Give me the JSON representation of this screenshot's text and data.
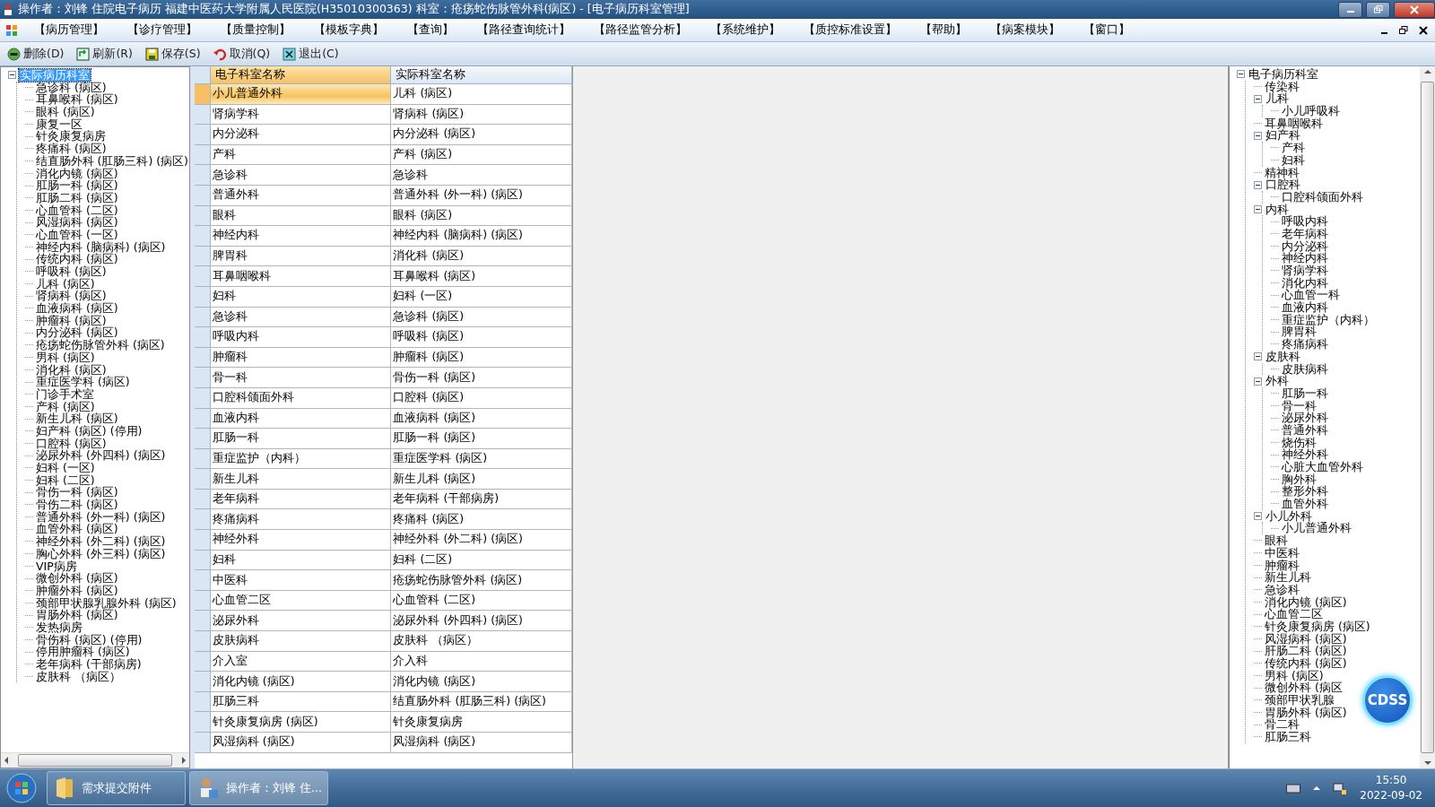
{
  "window": {
    "title": "操作者：刘锋 住院电子病历  福建中医药大学附属人民医院(H35010300363)  科室：疮疡蛇伤脉管外科(病区) - [电子病历科室管理]"
  },
  "menu": [
    "【病历管理】",
    "【诊疗管理】",
    "【质量控制】",
    "【模板字典】",
    "【查询】",
    "【路径查询统计】",
    "【路径监管分析】",
    "【系统维护】",
    "【质控标准设置】",
    "【帮助】",
    "【病案模块】",
    "【窗口】"
  ],
  "toolbar": [
    {
      "kind": "delete",
      "label": "删除(D)"
    },
    {
      "kind": "refresh",
      "label": "刷新(R)"
    },
    {
      "kind": "save",
      "label": "保存(S)"
    },
    {
      "kind": "cancel",
      "label": "取消(Q)"
    },
    {
      "kind": "exit",
      "label": "退出(C)"
    }
  ],
  "left_tree": {
    "label": "实际病历科室",
    "expanded": true,
    "selected": true,
    "children": [
      {
        "label": "急诊科 (病区)"
      },
      {
        "label": "耳鼻喉科 (病区)"
      },
      {
        "label": "眼科 (病区)"
      },
      {
        "label": "康复一区"
      },
      {
        "label": "针灸康复病房"
      },
      {
        "label": "疼痛科 (病区)"
      },
      {
        "label": "结直肠外科 (肛肠三科) (病区)"
      },
      {
        "label": "消化内镜 (病区)"
      },
      {
        "label": "肛肠一科 (病区)"
      },
      {
        "label": "肛肠二科 (病区)"
      },
      {
        "label": "心血管科 (二区)"
      },
      {
        "label": "风湿病科 (病区)"
      },
      {
        "label": "心血管科 (一区)"
      },
      {
        "label": "神经内科 (脑病科) (病区)"
      },
      {
        "label": "传统内科 (病区)"
      },
      {
        "label": "呼吸科 (病区)"
      },
      {
        "label": "儿科 (病区)"
      },
      {
        "label": "肾病科 (病区)"
      },
      {
        "label": "血液病科 (病区)"
      },
      {
        "label": "肿瘤科 (病区)"
      },
      {
        "label": "内分泌科 (病区)"
      },
      {
        "label": "疮疡蛇伤脉管外科 (病区)"
      },
      {
        "label": "男科 (病区)"
      },
      {
        "label": "消化科 (病区)"
      },
      {
        "label": "重症医学科 (病区)"
      },
      {
        "label": "门诊手术室"
      },
      {
        "label": "产科 (病区)"
      },
      {
        "label": "新生儿科 (病区)"
      },
      {
        "label": "妇产科 (病区) (停用)"
      },
      {
        "label": "口腔科 (病区)"
      },
      {
        "label": "泌尿外科 (外四科) (病区)"
      },
      {
        "label": "妇科 (一区)"
      },
      {
        "label": "妇科 (二区)"
      },
      {
        "label": "骨伤一科 (病区)"
      },
      {
        "label": "骨伤二科 (病区)"
      },
      {
        "label": "普通外科 (外一科) (病区)"
      },
      {
        "label": "血管外科 (病区)"
      },
      {
        "label": "神经外科 (外二科) (病区)"
      },
      {
        "label": "胸心外科 (外三科) (病区)"
      },
      {
        "label": "VIP病房"
      },
      {
        "label": "微创外科 (病区)"
      },
      {
        "label": "肿瘤外科 (病区)"
      },
      {
        "label": "颈部甲状腺乳腺外科 (病区)"
      },
      {
        "label": "胃肠外科 (病区)"
      },
      {
        "label": "发热病房"
      },
      {
        "label": "骨伤科 (病区) (停用)"
      },
      {
        "label": "停用肿瘤科 (病区)"
      },
      {
        "label": "老年病科 (干部病房)"
      },
      {
        "label": "皮肤科 （病区）"
      }
    ]
  },
  "table": {
    "columns": [
      "电子科室名称",
      "实际科室名称"
    ],
    "rows": [
      {
        "cells": [
          "小儿普通外科",
          "儿科 (病区)"
        ],
        "selected": true
      },
      {
        "cells": [
          "肾病学科",
          "肾病科 (病区)"
        ],
        "selected": false
      },
      {
        "cells": [
          "内分泌科",
          "内分泌科 (病区)"
        ],
        "selected": false
      },
      {
        "cells": [
          "产科",
          "产科 (病区)"
        ],
        "selected": false
      },
      {
        "cells": [
          "急诊科",
          "急诊科"
        ],
        "selected": false
      },
      {
        "cells": [
          "普通外科",
          "普通外科 (外一科) (病区)"
        ],
        "selected": false
      },
      {
        "cells": [
          "眼科",
          "眼科 (病区)"
        ],
        "selected": false
      },
      {
        "cells": [
          "神经内科",
          "神经内科 (脑病科) (病区)"
        ],
        "selected": false
      },
      {
        "cells": [
          "脾胃科",
          "消化科 (病区)"
        ],
        "selected": false
      },
      {
        "cells": [
          "耳鼻咽喉科",
          "耳鼻喉科 (病区)"
        ],
        "selected": false
      },
      {
        "cells": [
          "妇科",
          "妇科 (一区)"
        ],
        "selected": false
      },
      {
        "cells": [
          "急诊科",
          "急诊科 (病区)"
        ],
        "selected": false
      },
      {
        "cells": [
          "呼吸内科",
          "呼吸科 (病区)"
        ],
        "selected": false
      },
      {
        "cells": [
          "肿瘤科",
          "肿瘤科 (病区)"
        ],
        "selected": false
      },
      {
        "cells": [
          "骨一科",
          "骨伤一科 (病区)"
        ],
        "selected": false
      },
      {
        "cells": [
          "口腔科颌面外科",
          "口腔科 (病区)"
        ],
        "selected": false
      },
      {
        "cells": [
          "血液内科",
          "血液病科 (病区)"
        ],
        "selected": false
      },
      {
        "cells": [
          "肛肠一科",
          "肛肠一科 (病区)"
        ],
        "selected": false
      },
      {
        "cells": [
          "重症监护（内科）",
          "重症医学科 (病区)"
        ],
        "selected": false
      },
      {
        "cells": [
          "新生儿科",
          "新生儿科 (病区)"
        ],
        "selected": false
      },
      {
        "cells": [
          "老年病科",
          "老年病科 (干部病房)"
        ],
        "selected": false
      },
      {
        "cells": [
          "疼痛病科",
          "疼痛科 (病区)"
        ],
        "selected": false
      },
      {
        "cells": [
          "神经外科",
          "神经外科 (外二科) (病区)"
        ],
        "selected": false
      },
      {
        "cells": [
          "妇科",
          "妇科 (二区)"
        ],
        "selected": false
      },
      {
        "cells": [
          "中医科",
          "疮疡蛇伤脉管外科 (病区)"
        ],
        "selected": false
      },
      {
        "cells": [
          "心血管二区",
          "心血管科 (二区)"
        ],
        "selected": false
      },
      {
        "cells": [
          "泌尿外科",
          "泌尿外科 (外四科) (病区)"
        ],
        "selected": false
      },
      {
        "cells": [
          "皮肤病科",
          "皮肤科 （病区）"
        ],
        "selected": false
      },
      {
        "cells": [
          "介入室",
          "介入科"
        ],
        "selected": false
      },
      {
        "cells": [
          "消化内镜 (病区)",
          "消化内镜 (病区)"
        ],
        "selected": false
      },
      {
        "cells": [
          "肛肠三科",
          "结直肠外科 (肛肠三科) (病区)"
        ],
        "selected": false
      },
      {
        "cells": [
          "针灸康复病房 (病区)",
          "针灸康复病房"
        ],
        "selected": false
      },
      {
        "cells": [
          "风湿病科 (病区)",
          "风湿病科 (病区)"
        ],
        "selected": false
      }
    ]
  },
  "right_tree": {
    "label": "电子病历科室",
    "expanded": true,
    "children": [
      {
        "label": "传染科"
      },
      {
        "label": "儿科",
        "expanded": true,
        "children": [
          {
            "label": "小儿呼吸科"
          }
        ]
      },
      {
        "label": "耳鼻咽喉科"
      },
      {
        "label": "妇产科",
        "expanded": true,
        "children": [
          {
            "label": "产科"
          },
          {
            "label": "妇科"
          }
        ]
      },
      {
        "label": "精神科"
      },
      {
        "label": "口腔科",
        "expanded": true,
        "children": [
          {
            "label": "口腔科颌面外科"
          }
        ]
      },
      {
        "label": "内科",
        "expanded": true,
        "children": [
          {
            "label": "呼吸内科"
          },
          {
            "label": "老年病科"
          },
          {
            "label": "内分泌科"
          },
          {
            "label": "神经内科"
          },
          {
            "label": "肾病学科"
          },
          {
            "label": "消化内科"
          },
          {
            "label": "心血管一科"
          },
          {
            "label": "血液内科"
          },
          {
            "label": "重症监护（内科）"
          },
          {
            "label": "脾胃科"
          },
          {
            "label": "疼痛病科"
          }
        ]
      },
      {
        "label": "皮肤科",
        "expanded": true,
        "children": [
          {
            "label": "皮肤病科"
          }
        ]
      },
      {
        "label": "外科",
        "expanded": true,
        "children": [
          {
            "label": "肛肠一科"
          },
          {
            "label": "骨一科"
          },
          {
            "label": "泌尿外科"
          },
          {
            "label": "普通外科"
          },
          {
            "label": "烧伤科"
          },
          {
            "label": "神经外科"
          },
          {
            "label": "心脏大血管外科"
          },
          {
            "label": "胸外科"
          },
          {
            "label": "整形外科"
          },
          {
            "label": "血管外科"
          }
        ]
      },
      {
        "label": "小儿外科",
        "expanded": true,
        "children": [
          {
            "label": "小儿普通外科"
          }
        ]
      },
      {
        "label": "眼科"
      },
      {
        "label": "中医科"
      },
      {
        "label": "肿瘤科"
      },
      {
        "label": "新生儿科"
      },
      {
        "label": "急诊科"
      },
      {
        "label": "消化内镜 (病区)"
      },
      {
        "label": "心血管二区"
      },
      {
        "label": "针灸康复病房 (病区)"
      },
      {
        "label": "风湿病科 (病区)"
      },
      {
        "label": "肝肠二科 (病区)"
      },
      {
        "label": "传统内科 (病区)"
      },
      {
        "label": "男科 (病区)"
      },
      {
        "label": "微创外科 (病区"
      },
      {
        "label": "颈部甲状乳腺"
      },
      {
        "label": "胃肠外科 (病区)"
      },
      {
        "label": "骨二科"
      },
      {
        "label": "肛肠三科"
      }
    ]
  },
  "cdss_badge": "CDSS",
  "taskbar": {
    "tasks": [
      {
        "kind": "folder",
        "label": "需求提交附件"
      },
      {
        "kind": "app",
        "label": "操作者：刘锋 住..."
      }
    ],
    "time": "15:50",
    "date": "2022-09-02"
  }
}
